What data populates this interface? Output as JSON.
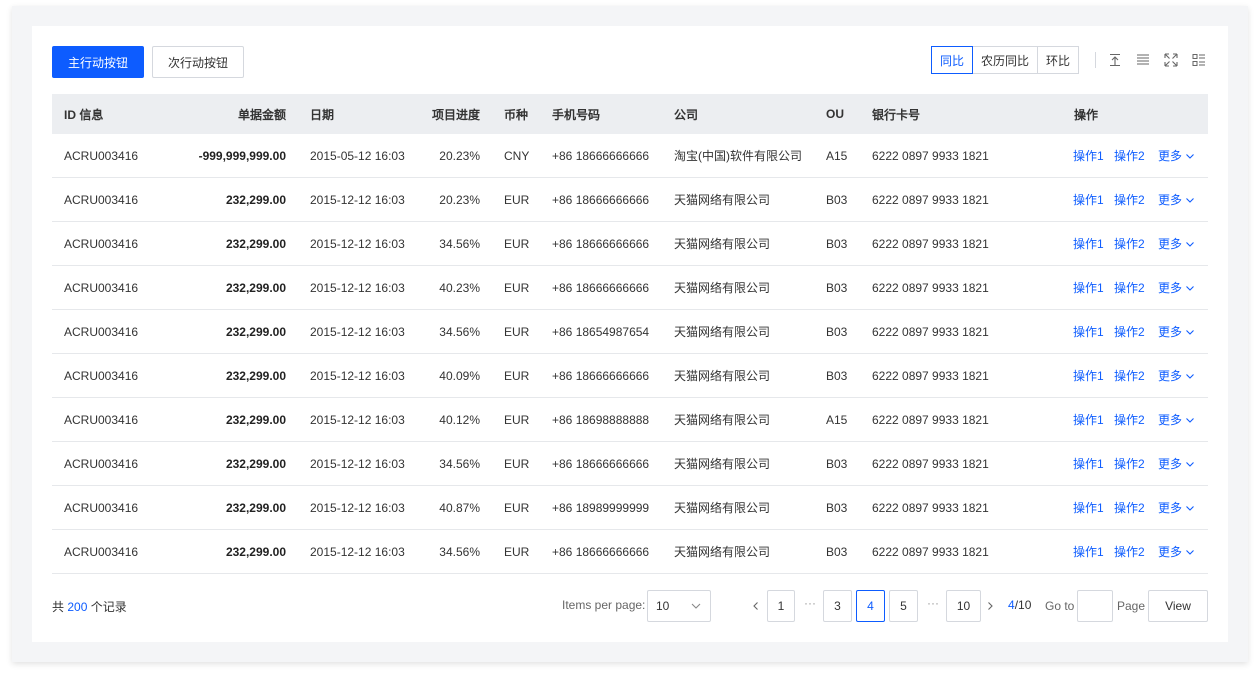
{
  "toolbar": {
    "primary_label": "主行动按钮",
    "secondary_label": "次行动按钮",
    "segments": [
      "同比",
      "农历同比",
      "环比"
    ],
    "active_segment": "同比",
    "tools": [
      "upload-icon",
      "density-icon",
      "fullscreen-icon",
      "column-settings-icon"
    ]
  },
  "table": {
    "headers": [
      "ID 信息",
      "单据金额",
      "日期",
      "项目进度",
      "币种",
      "手机号码",
      "公司",
      "OU",
      "银行卡号",
      "操作"
    ],
    "rows": [
      {
        "id": "ACRU003416",
        "amount": "-999,999,999.00",
        "date": "2015-05-12 16:03",
        "progress": "20.23%",
        "currency": "CNY",
        "phone": "+86 18666666666",
        "company": "淘宝(中国)软件有限公司",
        "ou": "A15",
        "card": "6222 0897 9933 1821"
      },
      {
        "id": "ACRU003416",
        "amount": "232,299.00",
        "date": "2015-12-12 16:03",
        "progress": "20.23%",
        "currency": "EUR",
        "phone": "+86 18666666666",
        "company": "天猫网络有限公司",
        "ou": "B03",
        "card": "6222 0897 9933 1821"
      },
      {
        "id": "ACRU003416",
        "amount": "232,299.00",
        "date": "2015-12-12 16:03",
        "progress": "34.56%",
        "currency": "EUR",
        "phone": "+86 18666666666",
        "company": "天猫网络有限公司",
        "ou": "B03",
        "card": "6222 0897 9933 1821"
      },
      {
        "id": "ACRU003416",
        "amount": "232,299.00",
        "date": "2015-12-12 16:03",
        "progress": "40.23%",
        "currency": "EUR",
        "phone": "+86 18666666666",
        "company": "天猫网络有限公司",
        "ou": "B03",
        "card": "6222 0897 9933 1821"
      },
      {
        "id": "ACRU003416",
        "amount": "232,299.00",
        "date": "2015-12-12 16:03",
        "progress": "34.56%",
        "currency": "EUR",
        "phone": "+86 18654987654",
        "company": "天猫网络有限公司",
        "ou": "B03",
        "card": "6222 0897 9933 1821"
      },
      {
        "id": "ACRU003416",
        "amount": "232,299.00",
        "date": "2015-12-12 16:03",
        "progress": "40.09%",
        "currency": "EUR",
        "phone": "+86 18666666666",
        "company": "天猫网络有限公司",
        "ou": "B03",
        "card": "6222 0897 9933 1821"
      },
      {
        "id": "ACRU003416",
        "amount": "232,299.00",
        "date": "2015-12-12 16:03",
        "progress": "40.12%",
        "currency": "EUR",
        "phone": "+86 18698888888",
        "company": "天猫网络有限公司",
        "ou": "A15",
        "card": "6222 0897 9933 1821"
      },
      {
        "id": "ACRU003416",
        "amount": "232,299.00",
        "date": "2015-12-12 16:03",
        "progress": "34.56%",
        "currency": "EUR",
        "phone": "+86 18666666666",
        "company": "天猫网络有限公司",
        "ou": "B03",
        "card": "6222 0897 9933 1821"
      },
      {
        "id": "ACRU003416",
        "amount": "232,299.00",
        "date": "2015-12-12 16:03",
        "progress": "40.87%",
        "currency": "EUR",
        "phone": "+86 18989999999",
        "company": "天猫网络有限公司",
        "ou": "B03",
        "card": "6222 0897 9933 1821"
      },
      {
        "id": "ACRU003416",
        "amount": "232,299.00",
        "date": "2015-12-12 16:03",
        "progress": "34.56%",
        "currency": "EUR",
        "phone": "+86 18666666666",
        "company": "天猫网络有限公司",
        "ou": "B03",
        "card": "6222 0897 9933 1821"
      }
    ],
    "actions": {
      "op1": "操作1",
      "op2": "操作2",
      "more": "更多"
    }
  },
  "footer": {
    "total_prefix": "共",
    "total_count": "200",
    "total_suffix": "个记录",
    "items_per_page_label": "Items per page:",
    "items_per_page_value": "10",
    "pages": [
      "1",
      "3",
      "4",
      "5",
      "10"
    ],
    "current_page": "4",
    "page_state_current": "4",
    "page_state_total": "/10",
    "ellipsis": "···",
    "goto_label": "Go to",
    "page_label": "Page",
    "view_label": "View"
  },
  "colors": {
    "accent": "#0d5cff",
    "header_bg": "#eceef1",
    "page_bg": "#f4f5f7"
  }
}
